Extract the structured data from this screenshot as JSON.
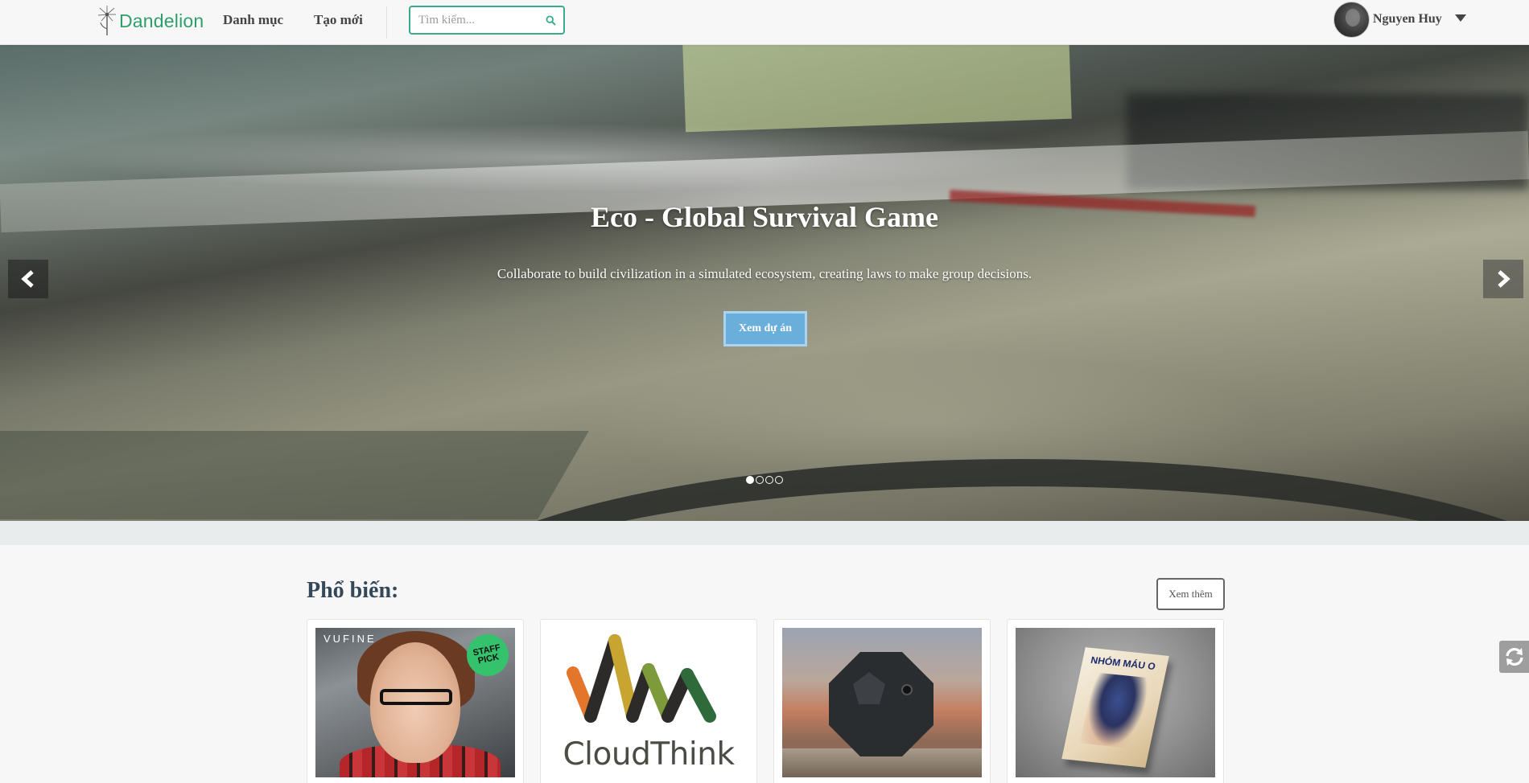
{
  "header": {
    "logo_text": "Dandelion",
    "nav": {
      "categories": "Danh mục",
      "create": "Tạo mới"
    },
    "search": {
      "placeholder": "Tìm kiếm...",
      "value": ""
    },
    "user": {
      "name": "Nguyen Huy"
    }
  },
  "hero": {
    "title": "Eco - Global Survival Game",
    "description": "Collaborate to build civilization in a simulated ecosystem, creating laws to make group decisions.",
    "button_label": "Xem dự án",
    "slide_count": 4,
    "active_slide": 1
  },
  "popular": {
    "title": "Phổ biến:",
    "more_label": "Xem thêm",
    "cards": [
      {
        "brand_text": "VUFINE",
        "badge_text": "STAFF PICK"
      },
      {
        "logo_text": "CloudThink"
      },
      {},
      {
        "book_title": "NHÓM MÁU O"
      }
    ]
  },
  "colors": {
    "brand_green": "#2e9f6a",
    "search_border": "#3aa98d",
    "hero_button": "#6aaedb",
    "section_title": "#34485a"
  }
}
